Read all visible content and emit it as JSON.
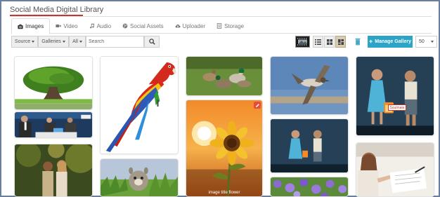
{
  "page": {
    "title": "Social Media Digital Library"
  },
  "tabs": [
    {
      "label": "Images",
      "icon": "camera-icon",
      "active": true
    },
    {
      "label": "Video",
      "icon": "video-icon",
      "active": false
    },
    {
      "label": "Audio",
      "icon": "music-icon",
      "active": false
    },
    {
      "label": "Social Assets",
      "icon": "globe-icon",
      "active": false
    },
    {
      "label": "Uploader",
      "icon": "cloud-upload-icon",
      "active": false
    },
    {
      "label": "Storage",
      "icon": "storage-icon",
      "active": false
    }
  ],
  "toolbar": {
    "source_label": "Source",
    "galleries_label": "Galleries",
    "all_label": "All",
    "search_placeholder": "Search",
    "manage_gallery_label": "Manage Gallery",
    "per_page_value": "50",
    "accent_color": "#2aa4c7"
  },
  "gallery": {
    "items": [
      {
        "name": "bonsai-tree"
      },
      {
        "name": "business-meeting"
      },
      {
        "name": "couple-in-park"
      },
      {
        "name": "parrot"
      },
      {
        "name": "squirrel"
      },
      {
        "name": "ducks-on-grass"
      },
      {
        "name": "sunflower",
        "caption": "image title flower"
      },
      {
        "name": "duck-in-flight"
      },
      {
        "name": "children-dark-background"
      },
      {
        "name": "purple-flowers"
      },
      {
        "name": "children-with-sign",
        "sign_text": "Soulmate"
      },
      {
        "name": "child-writing"
      }
    ]
  }
}
